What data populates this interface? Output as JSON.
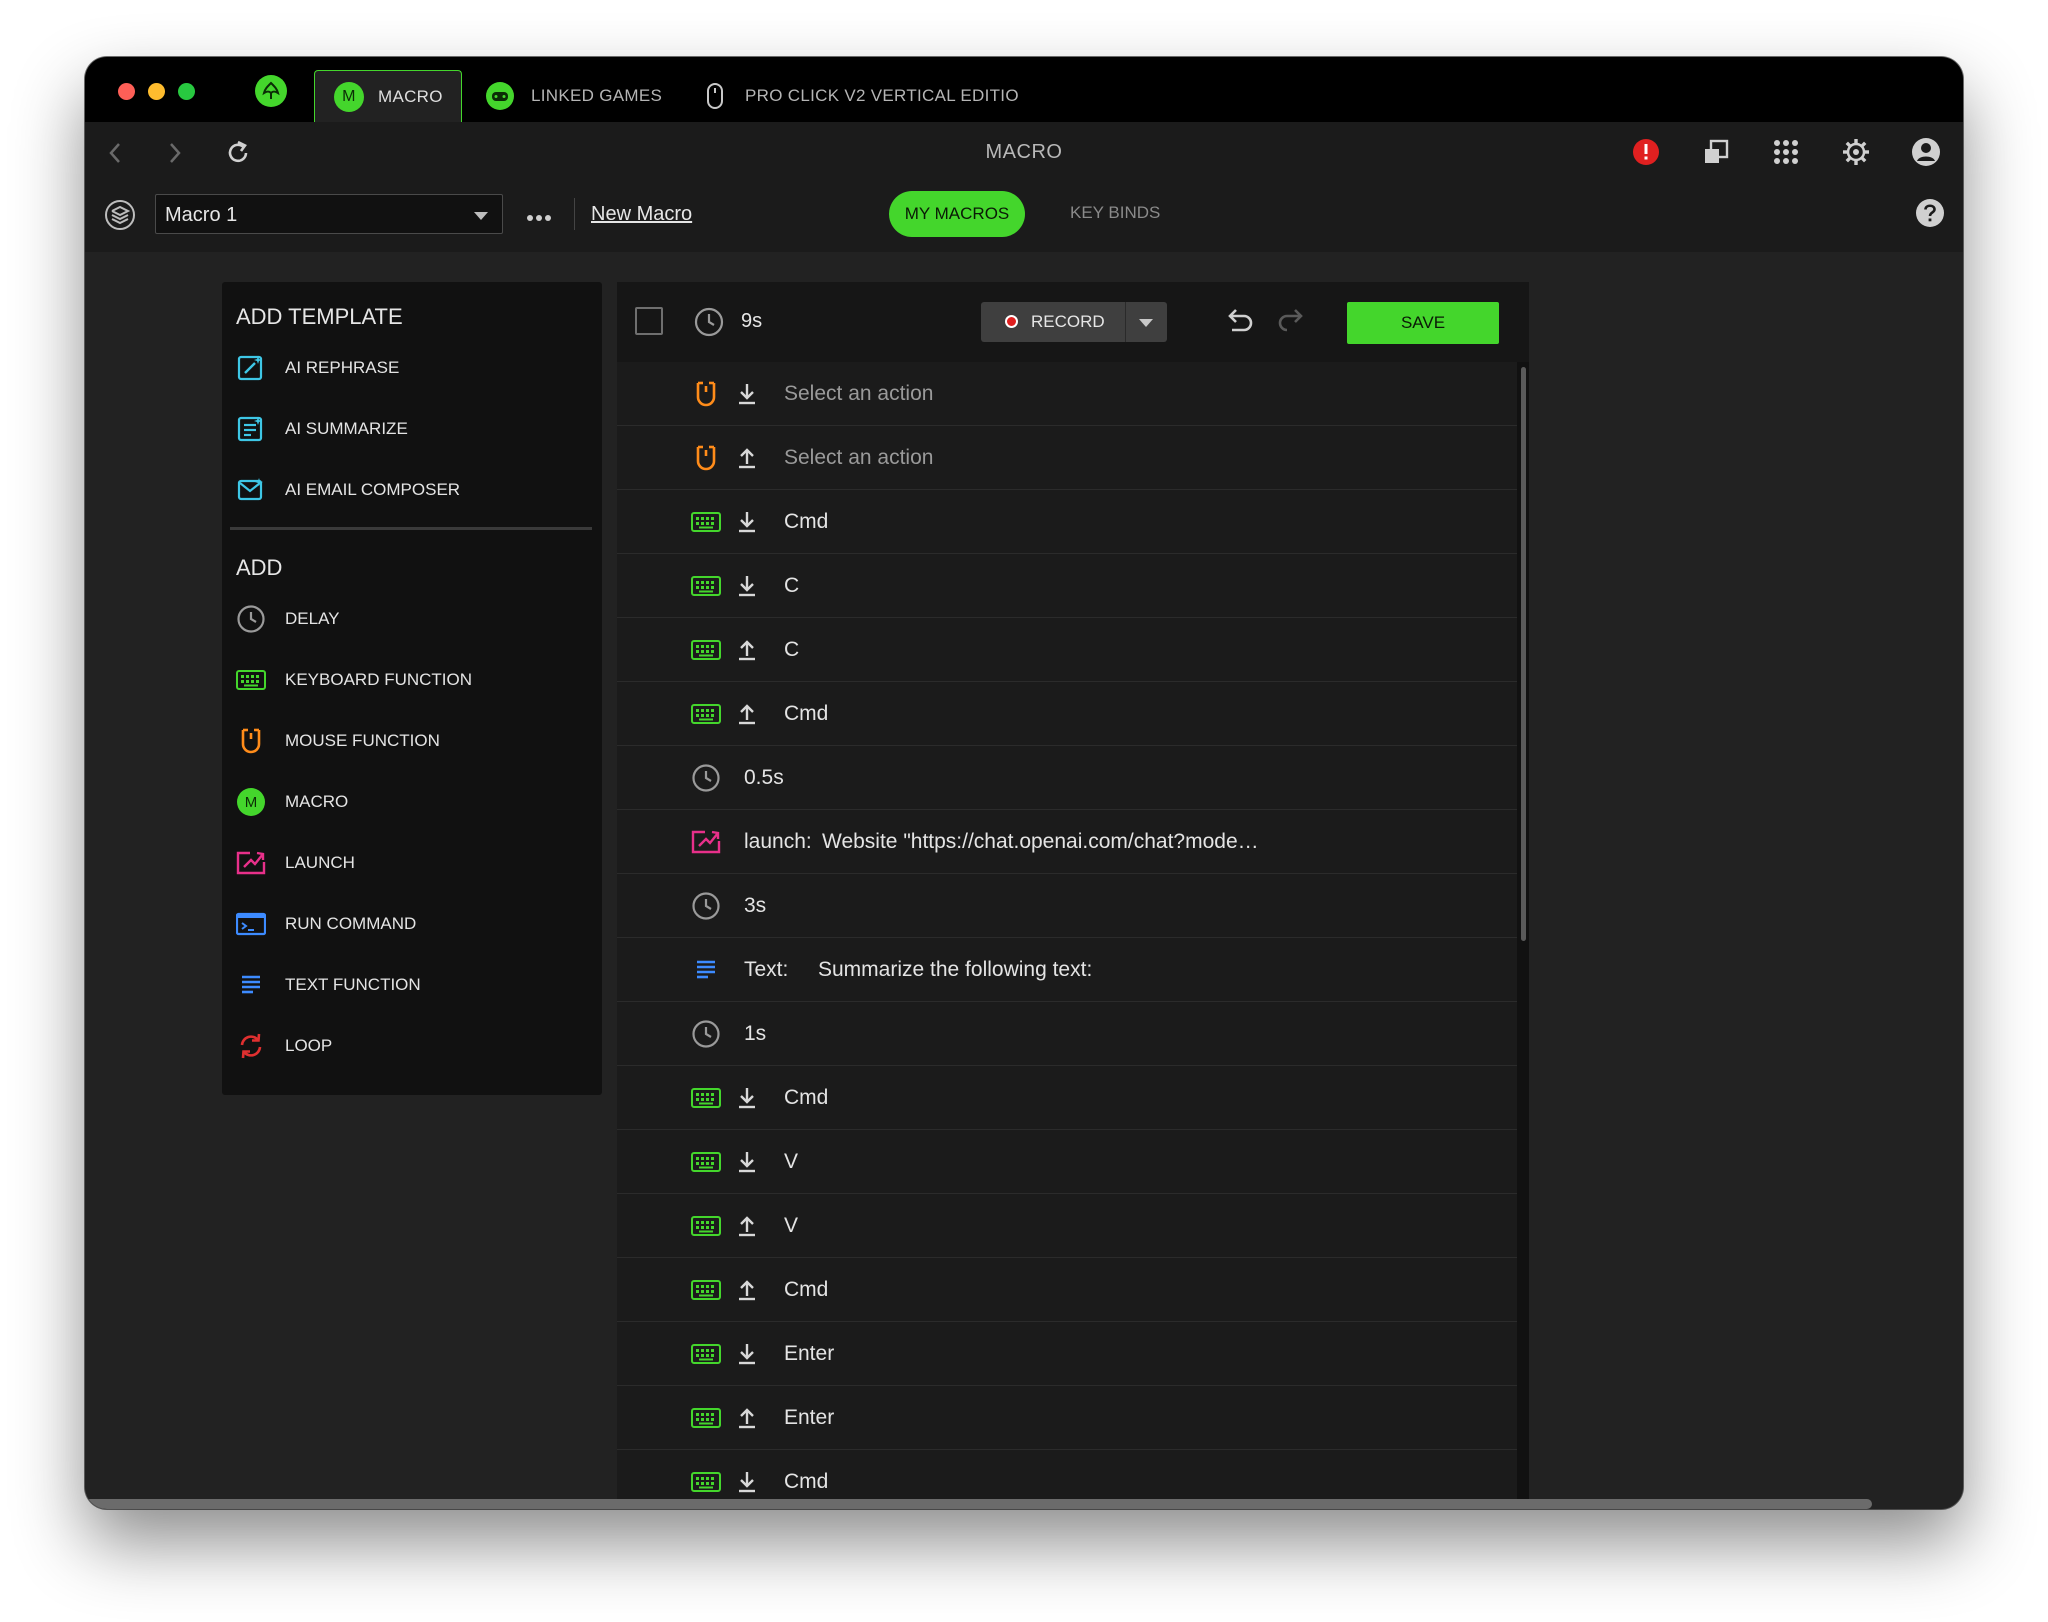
{
  "titlebar": {
    "tabs": [
      {
        "label": "MACRO",
        "icon": "m-icon",
        "icon_letter": "M"
      },
      {
        "label": "LINKED GAMES",
        "icon": "gamepad-icon"
      },
      {
        "label": "PRO CLICK V2 VERTICAL EDITIO",
        "icon": "mouse-icon"
      }
    ]
  },
  "navbar": {
    "title": "MACRO",
    "alert_color": "#e02020"
  },
  "toolbar": {
    "macro_select": "Macro 1",
    "new_macro": "New Macro",
    "tab_my_macros": "MY MACROS",
    "tab_key_binds": "KEY BINDS"
  },
  "left": {
    "template_title": "ADD TEMPLATE",
    "templates": [
      {
        "label": "AI REPHRASE",
        "icon": "ai-rephrase-icon"
      },
      {
        "label": "AI SUMMARIZE",
        "icon": "ai-summarize-icon"
      },
      {
        "label": "AI EMAIL COMPOSER",
        "icon": "ai-email-icon"
      }
    ],
    "add_title": "ADD",
    "add_items": [
      {
        "label": "DELAY",
        "icon": "clock-icon"
      },
      {
        "label": "KEYBOARD FUNCTION",
        "icon": "keyboard-icon"
      },
      {
        "label": "MOUSE FUNCTION",
        "icon": "mouse-icon"
      },
      {
        "label": "MACRO",
        "icon": "macro-icon",
        "icon_letter": "M"
      },
      {
        "label": "LAUNCH",
        "icon": "launch-icon"
      },
      {
        "label": "RUN COMMAND",
        "icon": "terminal-icon"
      },
      {
        "label": "TEXT FUNCTION",
        "icon": "text-icon"
      },
      {
        "label": "LOOP",
        "icon": "loop-icon"
      }
    ]
  },
  "editor": {
    "total_time": "9s",
    "record_label": "RECORD",
    "save_label": "SAVE",
    "rows": [
      {
        "type": "mouse",
        "dir": "down",
        "text": "Select an action",
        "placeholder": true
      },
      {
        "type": "mouse",
        "dir": "up",
        "text": "Select an action",
        "placeholder": true
      },
      {
        "type": "keyboard",
        "dir": "down",
        "text": "Cmd"
      },
      {
        "type": "keyboard",
        "dir": "down",
        "text": "C"
      },
      {
        "type": "keyboard",
        "dir": "up",
        "text": "C"
      },
      {
        "type": "keyboard",
        "dir": "up",
        "text": "Cmd"
      },
      {
        "type": "delay",
        "text": "0.5s"
      },
      {
        "type": "launch",
        "label": "launch:",
        "text": "Website \"https://chat.openai.com/chat?mode…"
      },
      {
        "type": "delay",
        "text": "3s"
      },
      {
        "type": "text",
        "label": "Text:",
        "text": "Summarize the following text:"
      },
      {
        "type": "delay",
        "text": "1s"
      },
      {
        "type": "keyboard",
        "dir": "down",
        "text": "Cmd"
      },
      {
        "type": "keyboard",
        "dir": "down",
        "text": "V"
      },
      {
        "type": "keyboard",
        "dir": "up",
        "text": "V"
      },
      {
        "type": "keyboard",
        "dir": "up",
        "text": "Cmd"
      },
      {
        "type": "keyboard",
        "dir": "down",
        "text": "Enter"
      },
      {
        "type": "keyboard",
        "dir": "up",
        "text": "Enter"
      },
      {
        "type": "keyboard",
        "dir": "down",
        "text": "Cmd"
      }
    ]
  },
  "colors": {
    "accent": "#44d62c",
    "mouse": "#ff8c1a",
    "launch": "#e8308a",
    "text_fn": "#3d8bff",
    "loop": "#e03030",
    "ai_cyan": "#3ec7e6"
  }
}
